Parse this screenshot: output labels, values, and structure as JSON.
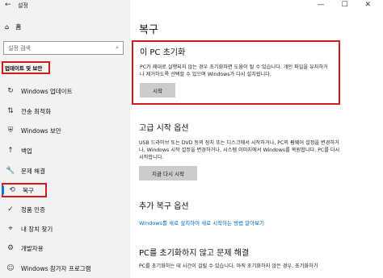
{
  "titlebar": {
    "title": "설정",
    "back": "←",
    "controls": "— ☐ ✕"
  },
  "sidebar": {
    "home": "홈",
    "search_placeholder": "설정 검색",
    "section_label": "업데이트 및 보안",
    "items": [
      {
        "label": "Windows 업데이트",
        "icon": "↻"
      },
      {
        "label": "전송 최적화",
        "icon": "⇅"
      },
      {
        "label": "Windows 보안",
        "icon": "⛨"
      },
      {
        "label": "백업",
        "icon": "↑"
      },
      {
        "label": "문제 해결",
        "icon": "🔧"
      },
      {
        "label": "복구",
        "icon": "⟲"
      },
      {
        "label": "정품 인증",
        "icon": "✓"
      },
      {
        "label": "내 장치 찾기",
        "icon": "⌖"
      },
      {
        "label": "개발자용",
        "icon": "⚙"
      },
      {
        "label": "Windows 참가자 프로그램",
        "icon": "☺"
      }
    ]
  },
  "main": {
    "title": "복구",
    "reset": {
      "heading": "이 PC 초기화",
      "desc": "PC가 제대로 실행되지 않는 경우 초기화하면 도움이 될 수 있습니다. 개인 파일을 유지하거나 제거하도록 선택할 수 있으며 Windows가 다시 설치됩니다.",
      "button": "시작"
    },
    "advanced": {
      "heading": "고급 시작 옵션",
      "desc": "USB 드라이브 또는 DVD 등의 장치 또는 디스크에서 시작하거나, PC의 펌웨어 설정을 변경하거나, Windows 시작 설정을 변경하거나, 시스템 이미지에서 Windows를 복원합니다. PC를 다시 시작합니다.",
      "button": "지금 다시 시작"
    },
    "more": {
      "heading": "추가 복구 옵션",
      "link": "Windows를 새로 설치하여 새로 시작하는 방법 알아보기"
    },
    "fix": {
      "heading": "PC를 초기화하지 않고 문제 해결",
      "desc": "PC를 초기화하는 데 시간이 걸릴 수 있습니다. 아직 초기화하지 않은 경우, 초기화하기"
    }
  }
}
